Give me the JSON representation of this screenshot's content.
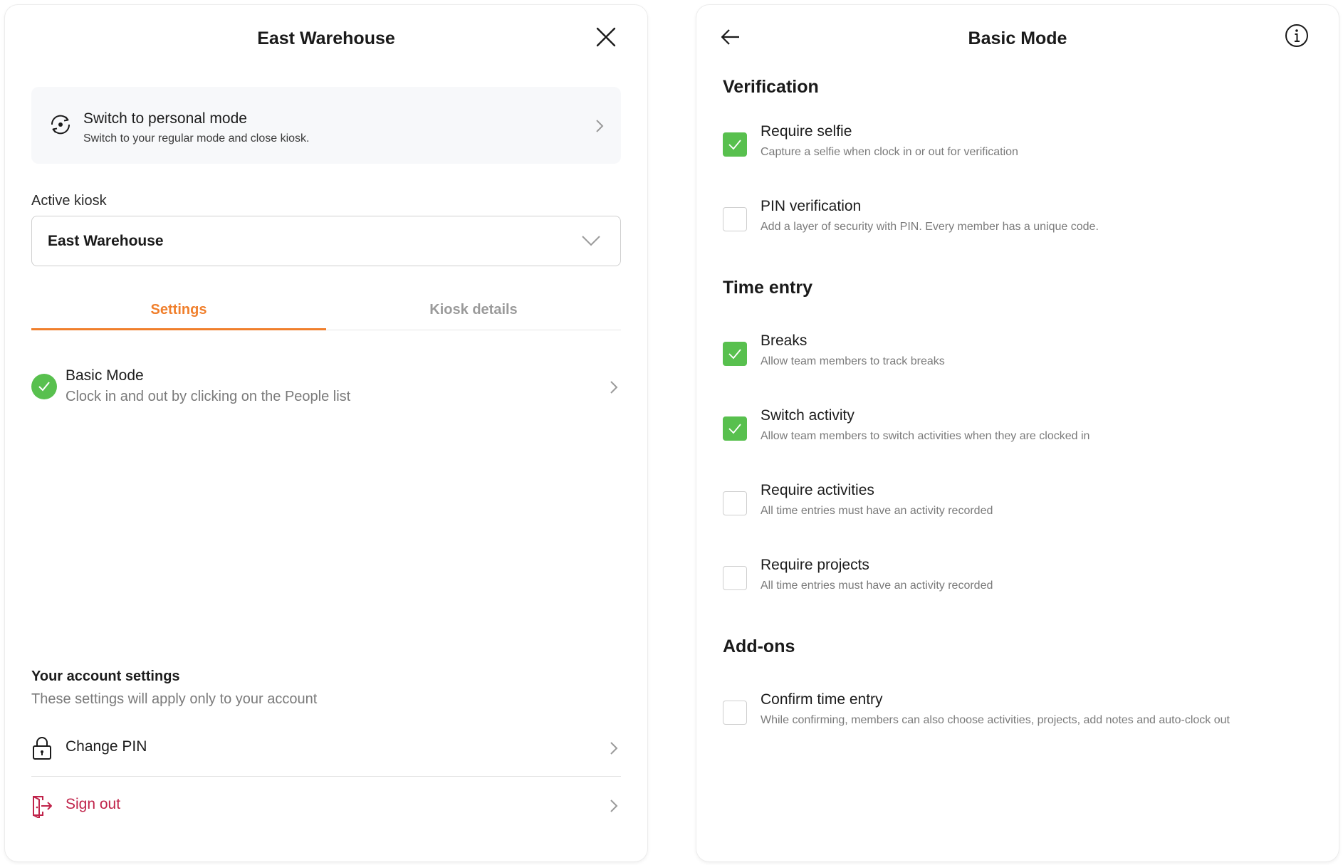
{
  "left_panel": {
    "title": "East Warehouse",
    "switch_card": {
      "title": "Switch to personal mode",
      "subtitle": "Switch to your regular mode and close kiosk."
    },
    "active_kiosk_label": "Active kiosk",
    "active_kiosk_value": "East Warehouse",
    "tabs": [
      {
        "label": "Settings",
        "active": true
      },
      {
        "label": "Kiosk details",
        "active": false
      }
    ],
    "mode_row": {
      "title": "Basic Mode",
      "subtitle": "Clock in and out by clicking on the People list"
    },
    "account": {
      "title": "Your account settings",
      "subtitle": "These settings will apply only to your account",
      "change_pin_label": "Change PIN",
      "sign_out_label": "Sign out"
    }
  },
  "right_panel": {
    "title": "Basic Mode",
    "sections": [
      {
        "heading": "Verification",
        "options": [
          {
            "title": "Require selfie",
            "subtitle": "Capture a selfie when clock in or out for verification",
            "checked": true
          },
          {
            "title": "PIN verification",
            "subtitle": "Add a layer of security with PIN. Every member has a unique code.",
            "checked": false
          }
        ]
      },
      {
        "heading": "Time entry",
        "options": [
          {
            "title": "Breaks",
            "subtitle": "Allow team members to track breaks",
            "checked": true
          },
          {
            "title": "Switch activity",
            "subtitle": "Allow team members to switch activities when they are clocked in",
            "checked": true
          },
          {
            "title": "Require activities",
            "subtitle": "All time entries must have an activity recorded",
            "checked": false
          },
          {
            "title": "Require projects",
            "subtitle": "All time entries must have an activity recorded",
            "checked": false
          }
        ]
      },
      {
        "heading": "Add-ons",
        "options": [
          {
            "title": "Confirm time entry",
            "subtitle": "While confirming, members can also choose activities, projects, add notes and auto-clock out",
            "checked": false
          }
        ]
      }
    ]
  },
  "colors": {
    "accent": "#f07f2c",
    "check_green": "#58c04e",
    "danger": "#c0234a"
  },
  "icons": {
    "close": "close-icon",
    "switch_mode": "switch-mode-icon",
    "chevron_right": "chevron-right-icon",
    "chevron_down": "chevron-down-icon",
    "check": "check-icon",
    "lock": "lock-icon",
    "sign_out": "sign-out-icon",
    "back": "back-arrow-icon",
    "info": "info-icon"
  }
}
